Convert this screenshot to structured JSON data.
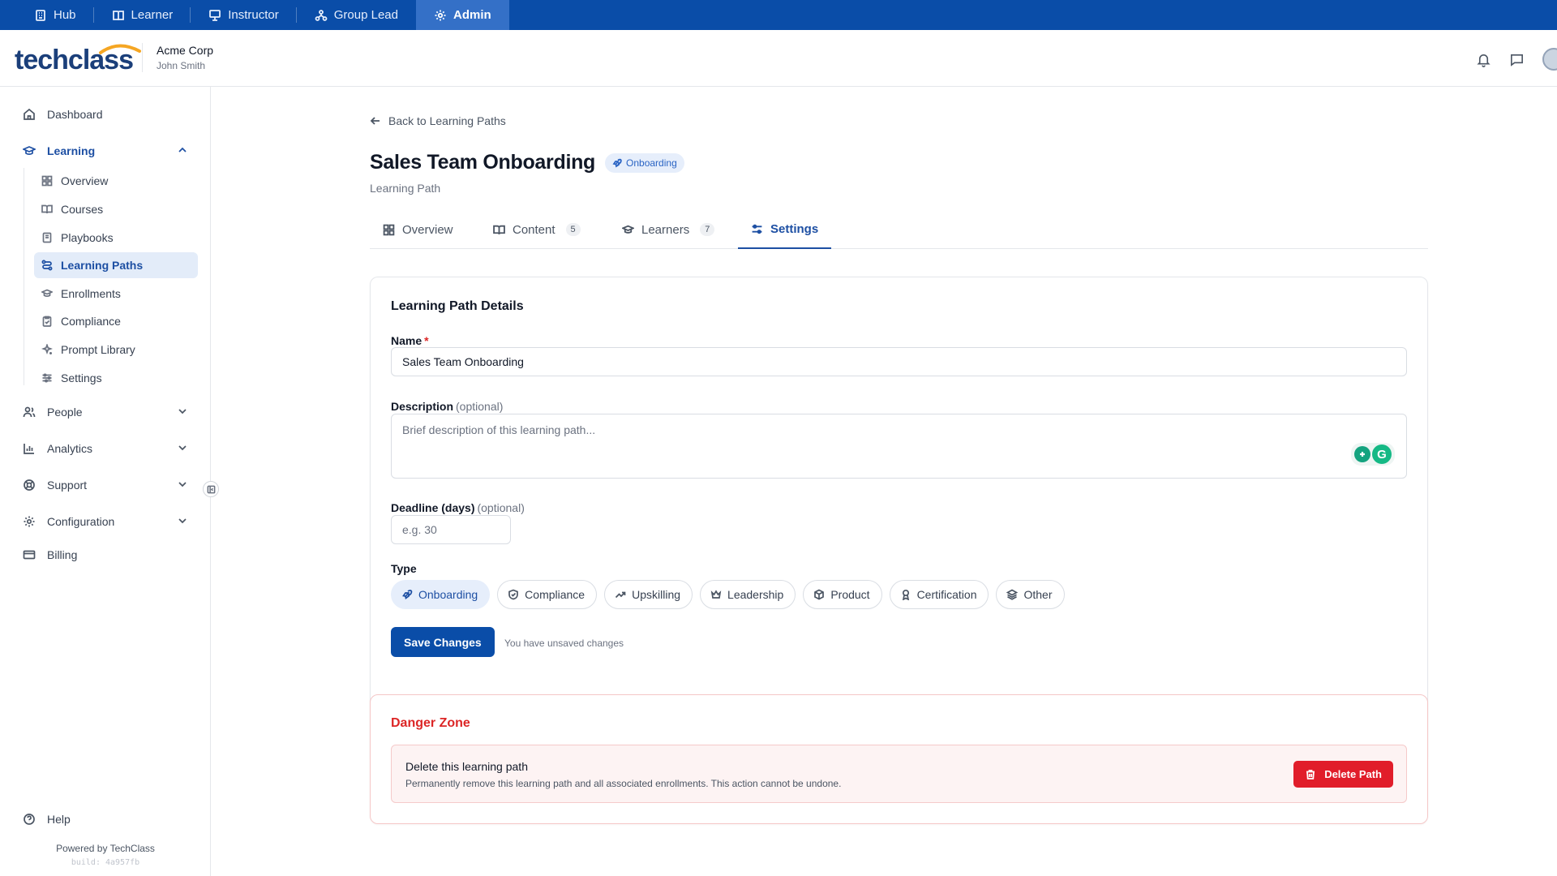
{
  "role_bar": {
    "items": [
      {
        "label": "Hub",
        "icon": "building-icon"
      },
      {
        "label": "Learner",
        "icon": "book-icon"
      },
      {
        "label": "Instructor",
        "icon": "presentation-icon"
      },
      {
        "label": "Group Lead",
        "icon": "group-icon"
      },
      {
        "label": "Admin",
        "icon": "gear-icon",
        "active": true
      }
    ]
  },
  "header": {
    "logo_text": "techclass",
    "org_name": "Acme Corp",
    "user_name": "John Smith"
  },
  "sidebar": {
    "dashboard": "Dashboard",
    "learning": "Learning",
    "learning_items": [
      "Overview",
      "Courses",
      "Playbooks",
      "Learning Paths",
      "Enrollments",
      "Compliance",
      "Prompt Library",
      "Settings"
    ],
    "people": "People",
    "analytics": "Analytics",
    "support": "Support",
    "configuration": "Configuration",
    "billing": "Billing",
    "help": "Help",
    "powered_by": "Powered by TechClass",
    "build": "build: 4a957fb"
  },
  "page": {
    "back_link": "Back to Learning Paths",
    "title": "Sales Team Onboarding",
    "badge": "Onboarding",
    "subtitle": "Learning Path",
    "tabs": [
      {
        "label": "Overview"
      },
      {
        "label": "Content",
        "count": "5"
      },
      {
        "label": "Learners",
        "count": "7"
      },
      {
        "label": "Settings",
        "active": true
      }
    ]
  },
  "details": {
    "title": "Learning Path Details",
    "name_label": "Name",
    "name_required": "*",
    "name_value": "Sales Team Onboarding",
    "description_label": "Description",
    "description_optional": "(optional)",
    "description_placeholder": "Brief description of this learning path...",
    "deadline_label": "Deadline (days)",
    "deadline_optional": "(optional)",
    "deadline_placeholder": "e.g. 30",
    "type_label": "Type",
    "types": [
      "Onboarding",
      "Compliance",
      "Upskilling",
      "Leadership",
      "Product",
      "Certification",
      "Other"
    ],
    "selected_type": "Onboarding",
    "save_label": "Save Changes",
    "unsaved_text": "You have unsaved changes"
  },
  "danger": {
    "title": "Danger Zone",
    "heading": "Delete this learning path",
    "text": "Permanently remove this learning path and all associated enrollments. This action cannot be undone.",
    "delete_label": "Delete Path"
  },
  "colors": {
    "brand": "#0a4da8",
    "active_nav_bg": "#e3ecf9",
    "danger": "#e11d2a"
  }
}
